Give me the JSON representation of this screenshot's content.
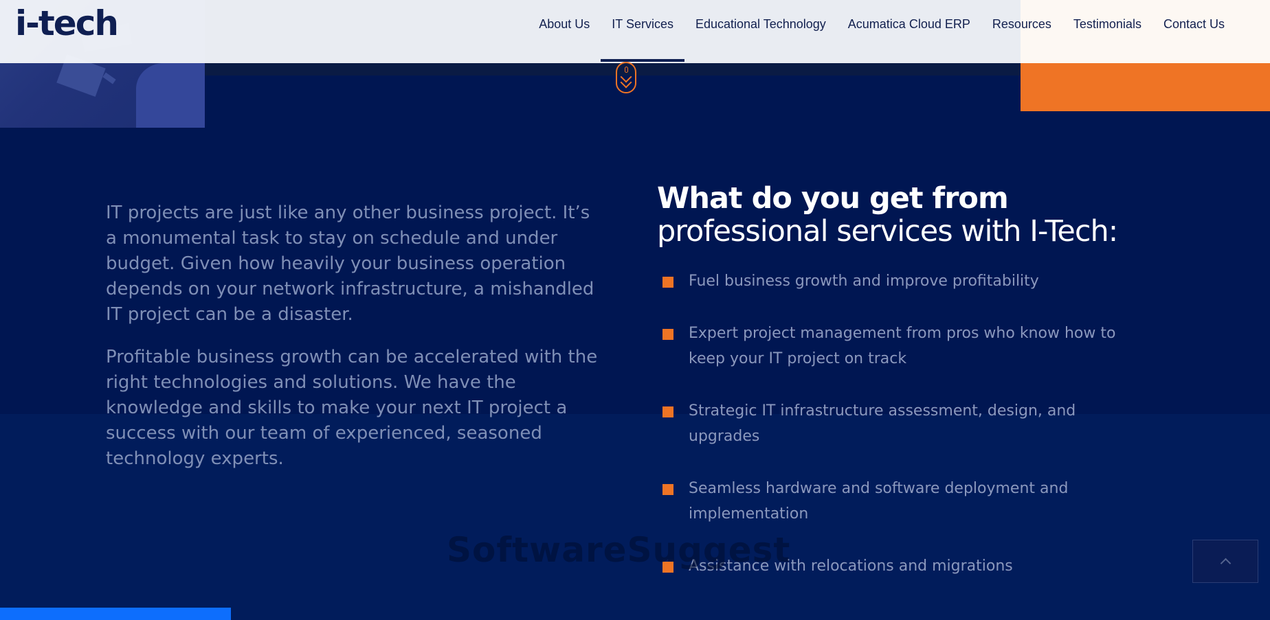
{
  "brand": {
    "logo_text": "i-tech"
  },
  "nav": {
    "items": [
      {
        "label": "About Us"
      },
      {
        "label": "IT Services"
      },
      {
        "label": "Educational Technology"
      },
      {
        "label": "Acumatica Cloud ERP"
      },
      {
        "label": "Resources"
      },
      {
        "label": "Testimonials"
      },
      {
        "label": "Contact Us"
      }
    ],
    "active_index": 1
  },
  "intro": {
    "paragraphs": [
      "IT projects are just like any other business project. It’s a monumental task to stay on schedule and under budget. Given how heavily your business operation depends on your network infrastructure, a mishandled IT project can be a disaster.",
      "Profitable business growth can be accelerated with the right technologies and solutions. We have the knowledge and skills to make your next IT project a success with our team of experienced, seasoned technology experts."
    ]
  },
  "benefits_section": {
    "heading_bold": "What do you get from",
    "heading_light": "professional services with I-Tech:",
    "items": [
      "Fuel business growth and improve profitability",
      "Expert project management from pros who know how to keep your IT project on track",
      "Strategic IT infrastructure assessment, design, and upgrades",
      "Seamless hardware and software deployment and implementation",
      "Assistance with relocations and migrations"
    ]
  },
  "watermark": {
    "text": "SoftwareSuggest"
  },
  "colors": {
    "background": "#001a58",
    "accent_orange": "#ef7425",
    "header_bg": "#f6f8fb",
    "nav_text": "#12204f",
    "body_text": "#7f8fb6",
    "bright_blue": "#0d6efd"
  },
  "icons": {
    "scroll_indicator": "mouse-scroll-icon",
    "back_to_top": "chevron-up-icon",
    "bullet": "orange-square-bullet"
  }
}
